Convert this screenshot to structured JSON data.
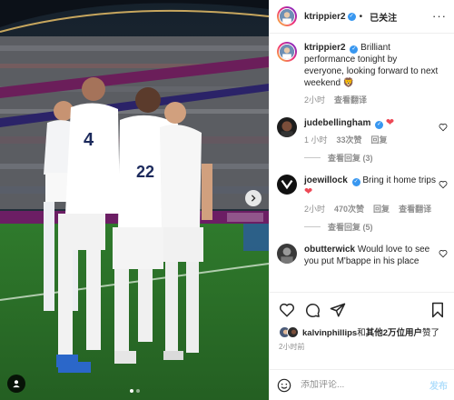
{
  "header": {
    "username": "ktrippier2",
    "separator": "•",
    "follow_label": "已关注",
    "more_label": "···"
  },
  "caption": {
    "username": "ktrippier2",
    "text": "Brilliant performance tonight by everyone, looking forward to next weekend",
    "emoji": "🦁",
    "time": "2小时",
    "translate_label": "查看翻译"
  },
  "comments": [
    {
      "username": "judebellingham",
      "text": "",
      "emoji": "❤",
      "time": "1 小时",
      "likes": "33次赞",
      "reply_label": "回复",
      "replies_label": "查看回复 (3)"
    },
    {
      "username": "joewillock",
      "text": "Bring it home trips",
      "emoji": "❤",
      "time": "2小时",
      "likes": "470次赞",
      "reply_label": "回复",
      "translate_label": "查看翻译",
      "replies_label": "查看回复 (5)"
    },
    {
      "username": "obutterwick",
      "text": "Would love to see you put M'bappe in his place"
    }
  ],
  "likes": {
    "user": "kalvinphillips",
    "suffix_bold": "其他2万位用户",
    "mid": "和",
    "tail": "赞了"
  },
  "post_time": "2小时前",
  "add_comment": {
    "placeholder": "添加评论...",
    "post_label": "发布"
  },
  "colors": {
    "accent": "#0095f6",
    "like_red": "#ed4956",
    "verified_blue": "#3897f0",
    "muted": "#8e8e8e"
  },
  "icons": [
    "heart-icon",
    "comment-icon",
    "share-icon",
    "bookmark-icon",
    "emoji-icon",
    "more-icon",
    "verified-icon",
    "chevron-right-icon",
    "user-tag-icon"
  ]
}
